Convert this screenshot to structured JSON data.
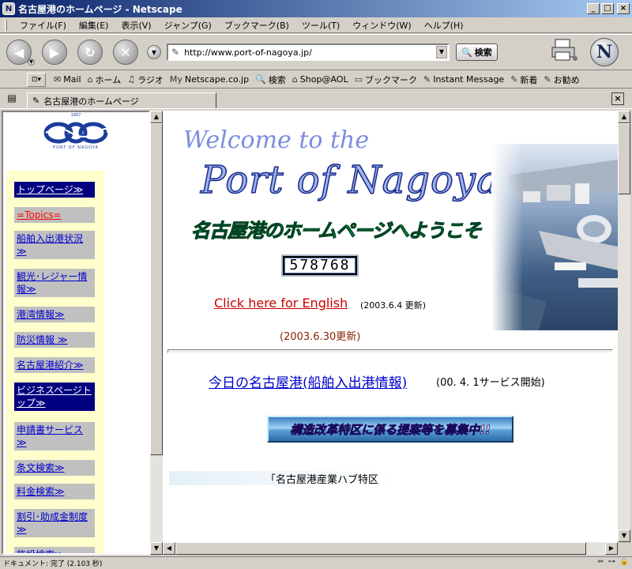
{
  "window": {
    "title": "名古屋港のホームページ - Netscape",
    "app_icon": "N"
  },
  "menu": [
    "ファイル(F)",
    "編集(E)",
    "表示(V)",
    "ジャンプ(G)",
    "ブックマーク(B)",
    "ツール(T)",
    "ウィンドウ(W)",
    "ヘルプ(H)"
  ],
  "nav": {
    "url": "http://www.port-of-nagoya.jp/",
    "search_label": "検索",
    "logo_letter": "N"
  },
  "personal_toolbar": [
    "Mail",
    "ホーム",
    "ラジオ",
    "Netscape.co.jp",
    "検索",
    "Shop@AOL",
    "ブックマーク",
    "Instant Message",
    "新着",
    "お勧め"
  ],
  "tab": {
    "title": "名古屋港のホームページ"
  },
  "sidebar": {
    "logo_text": "PORT OF NAGOYA",
    "logo_year": "1907",
    "items": [
      "トップページ≫",
      "=Topics=",
      "船舶入出港状況≫",
      "観光･レジャー情報≫",
      "港湾情報≫",
      "防災情報 ≫",
      "名古屋港紹介≫",
      "ビジネスページトップ≫",
      "申請書サービス≫",
      "条文検索≫",
      "料金検索≫",
      "割引･助成金制度≫",
      "施設検索≫"
    ]
  },
  "main": {
    "welcome": "Welcome to the",
    "port": "Port of Nagoya",
    "jp_welcome": "名古屋港のホームページへようこそ",
    "counter": "578768",
    "english_link": "Click here for English",
    "english_note": "(2003.6.4 更新)",
    "update": "(2003.6.30更新)",
    "today_link": "今日の名古屋港(船舶入出港情報)",
    "today_note": "(00. 4. 1サービス開始)",
    "banner": "構造改革特区に係る提案等を募集中!!",
    "marquee": "「名古屋港産業ハブ特区"
  },
  "status": {
    "text": "ドキュメント: 完了 (2.103 秒)"
  }
}
